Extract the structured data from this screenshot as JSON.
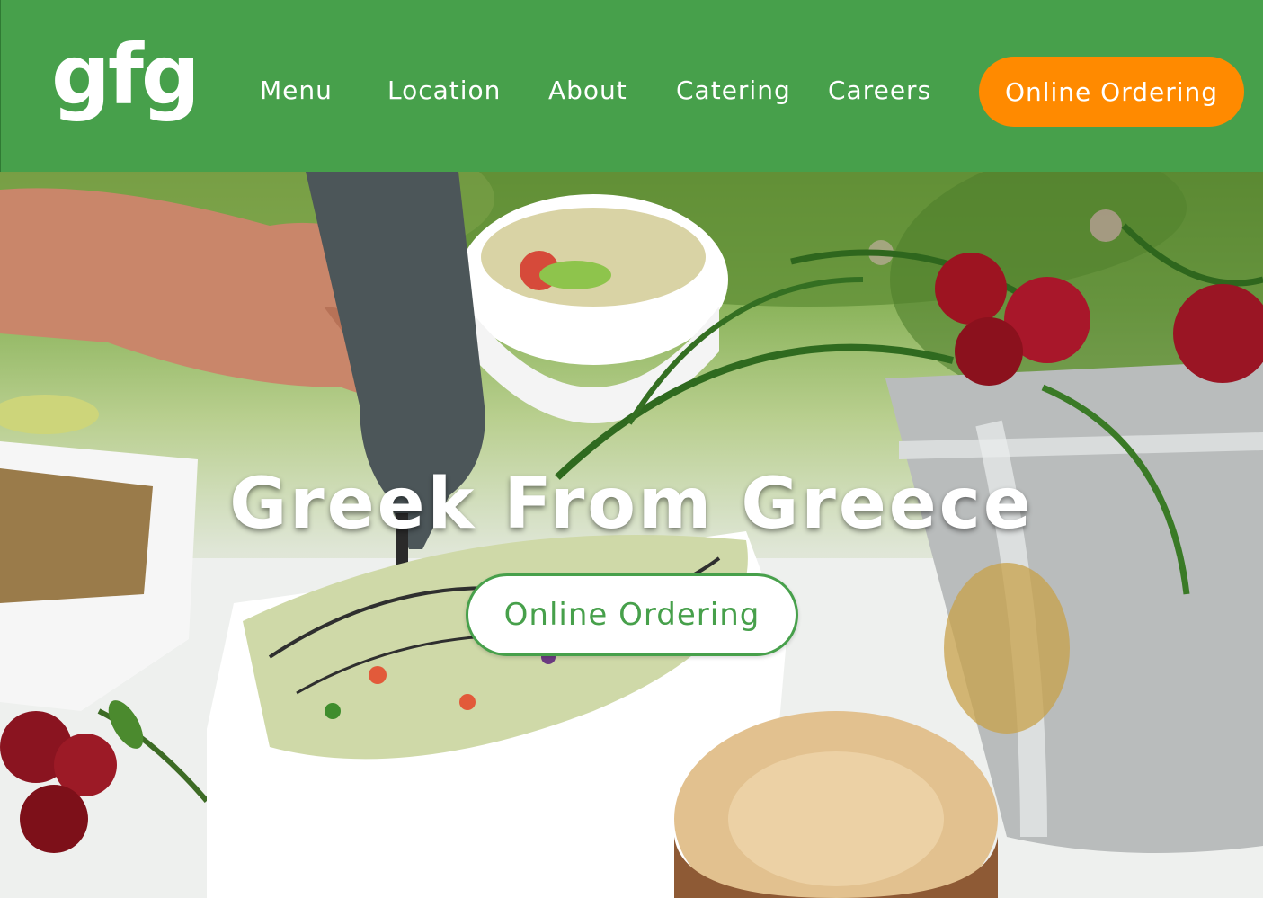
{
  "brand": {
    "logo_text": "gfg"
  },
  "nav": {
    "items": [
      {
        "label": "Menu"
      },
      {
        "label": "Location"
      },
      {
        "label": "About"
      },
      {
        "label": "Catering"
      },
      {
        "label": "Careers"
      }
    ],
    "order_button_label": "Online Ordering"
  },
  "hero": {
    "title": "Greek From Greece",
    "order_button_label": "Online Ordering",
    "image_subject": "salad-bowl-and-flower-bucket-photo"
  },
  "colors": {
    "header_bg": "#47a04b",
    "accent_orange": "#ff8a00",
    "hero_button_text": "#47a04b"
  }
}
